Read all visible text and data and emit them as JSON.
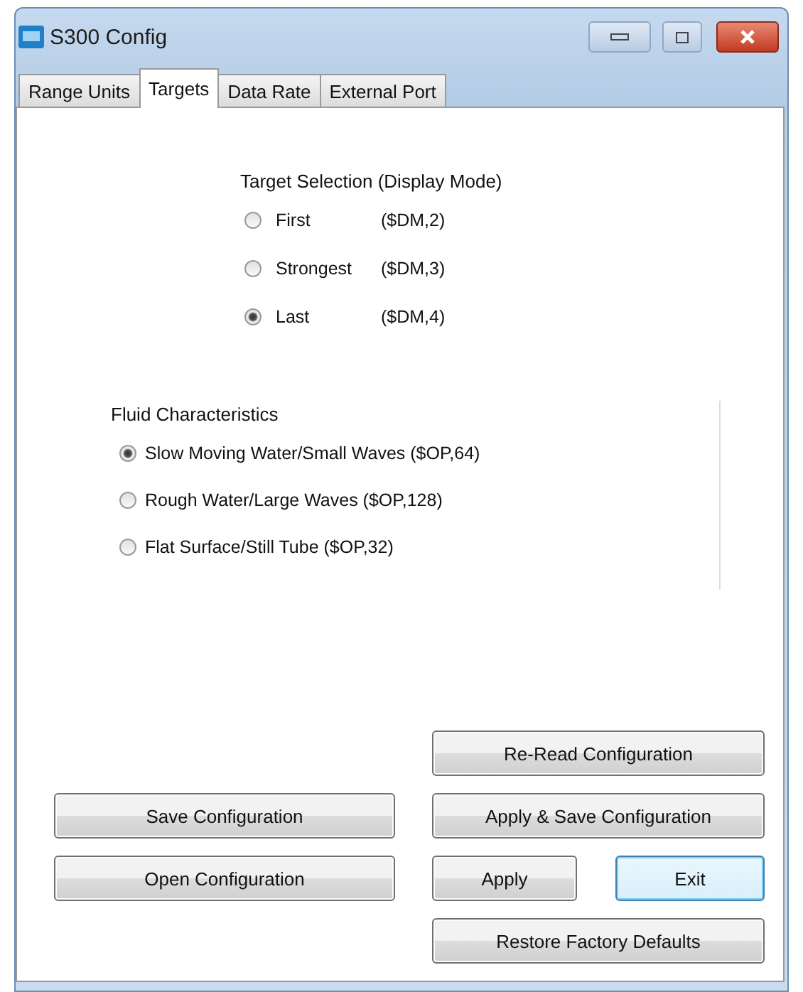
{
  "window": {
    "title": "S300 Config"
  },
  "tabs": [
    {
      "label": "Range Units",
      "selected": false
    },
    {
      "label": "Targets",
      "selected": true
    },
    {
      "label": "Data Rate",
      "selected": false
    },
    {
      "label": "External Port",
      "selected": false
    }
  ],
  "target_selection": {
    "title": "Target Selection (Display Mode)",
    "options": [
      {
        "label": "First",
        "code": "($DM,2)",
        "selected": false
      },
      {
        "label": "Strongest",
        "code": "($DM,3)",
        "selected": false
      },
      {
        "label": "Last",
        "code": "($DM,4)",
        "selected": true
      }
    ]
  },
  "fluid_characteristics": {
    "title": "Fluid Characteristics",
    "options": [
      {
        "label": "Slow Moving Water/Small Waves ($OP,64)",
        "selected": true
      },
      {
        "label": "Rough Water/Large Waves ($OP,128)",
        "selected": false
      },
      {
        "label": "Flat Surface/Still Tube ($OP,32)",
        "selected": false
      }
    ]
  },
  "buttons": [
    {
      "label": "Re-Read Configuration",
      "default": false
    },
    {
      "label": "Save Configuration",
      "default": false
    },
    {
      "label": "Apply & Save Configuration",
      "default": false
    },
    {
      "label": "Open Configuration",
      "default": false
    },
    {
      "label": "Apply",
      "default": false
    },
    {
      "label": "Exit",
      "default": true
    },
    {
      "label": "Restore Factory Defaults",
      "default": false
    }
  ]
}
